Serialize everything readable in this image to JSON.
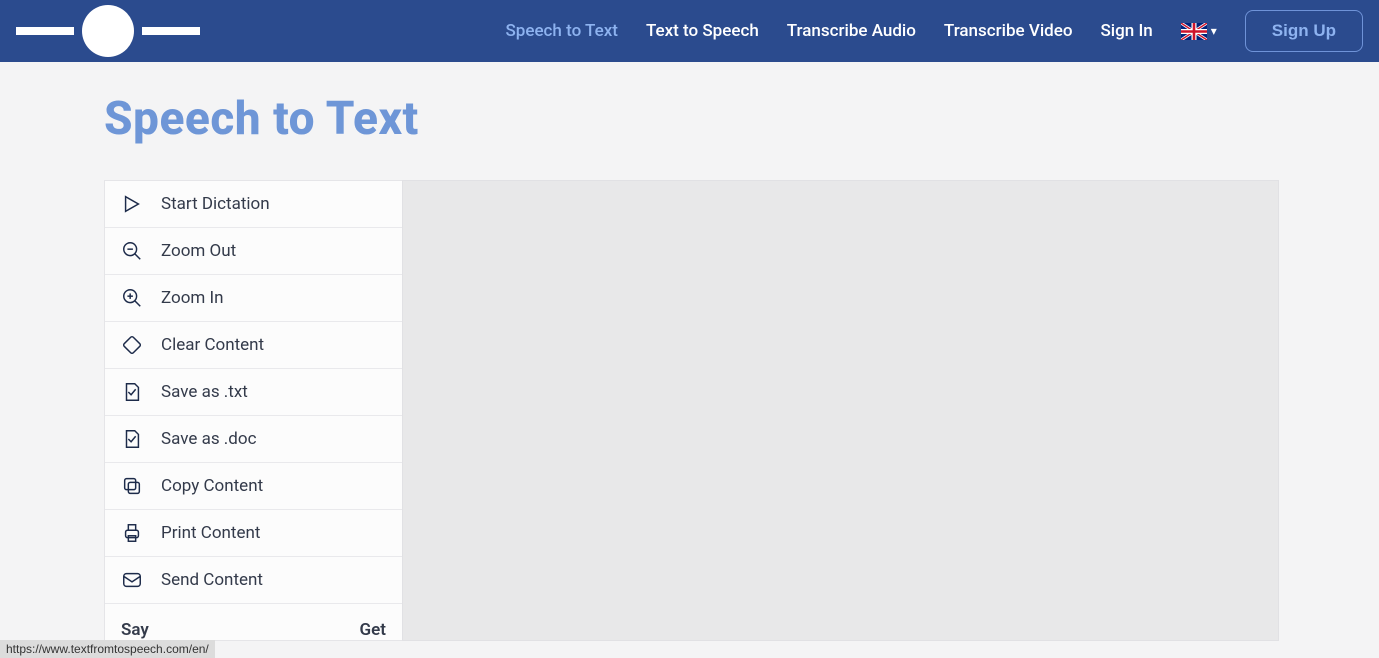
{
  "header": {
    "nav": [
      {
        "label": "Speech to Text",
        "active": true
      },
      {
        "label": "Text to Speech",
        "active": false
      },
      {
        "label": "Transcribe Audio",
        "active": false
      },
      {
        "label": "Transcribe Video",
        "active": false
      },
      {
        "label": "Sign In",
        "active": false
      }
    ],
    "signup_label": "Sign Up"
  },
  "page": {
    "title": "Speech to Text"
  },
  "sidebar": {
    "items": [
      {
        "label": "Start Dictation",
        "icon": "play-icon"
      },
      {
        "label": "Zoom Out",
        "icon": "zoom-out-icon"
      },
      {
        "label": "Zoom In",
        "icon": "zoom-in-icon"
      },
      {
        "label": "Clear Content",
        "icon": "eraser-icon"
      },
      {
        "label": "Save as .txt",
        "icon": "file-txt-icon"
      },
      {
        "label": "Save as .doc",
        "icon": "file-doc-icon"
      },
      {
        "label": "Copy Content",
        "icon": "copy-icon"
      },
      {
        "label": "Print Content",
        "icon": "print-icon"
      },
      {
        "label": "Send Content",
        "icon": "mail-icon"
      }
    ],
    "footer_left": "Say",
    "footer_right": "Get"
  },
  "status_url": "https://www.textfromtospeech.com/en/"
}
